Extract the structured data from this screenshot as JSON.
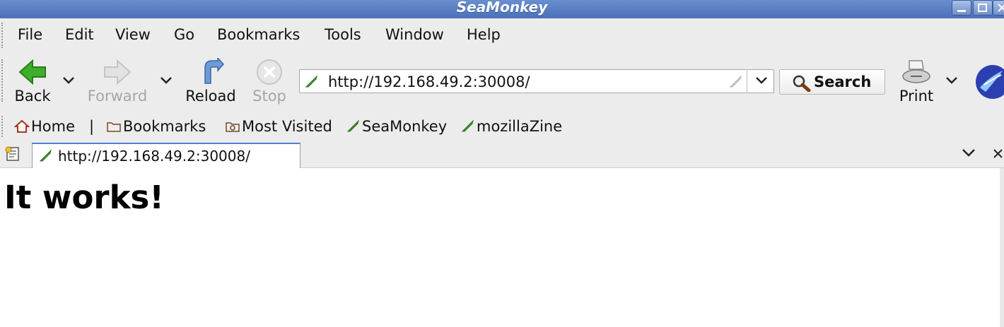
{
  "window": {
    "title": "SeaMonkey"
  },
  "menu": {
    "items": [
      {
        "label": "File"
      },
      {
        "label": "Edit"
      },
      {
        "label": "View"
      },
      {
        "label": "Go"
      },
      {
        "label": "Bookmarks"
      },
      {
        "label": "Tools"
      },
      {
        "label": "Window"
      },
      {
        "label": "Help"
      }
    ]
  },
  "toolbar": {
    "back_label": "Back",
    "forward_label": "Forward",
    "reload_label": "Reload",
    "stop_label": "Stop",
    "search_label": "Search",
    "print_label": "Print",
    "url": "http://192.168.49.2:30008/",
    "icons": {
      "back": "back-arrow-icon",
      "forward": "forward-arrow-icon",
      "reload": "reload-icon",
      "stop": "stop-icon",
      "search": "magnifier-icon",
      "print": "printer-icon",
      "throbber": "seamonkey-logo-icon"
    }
  },
  "bookmarks": {
    "items": [
      {
        "label": "Home",
        "icon": "home-icon"
      },
      {
        "label": "|",
        "icon": ""
      },
      {
        "label": "Bookmarks",
        "icon": "folder-icon"
      },
      {
        "label": "Most Visited",
        "icon": "folder-icon"
      },
      {
        "label": "SeaMonkey",
        "icon": "bookmark-leaf-icon"
      },
      {
        "label": "mozillaZine",
        "icon": "bookmark-leaf-icon"
      }
    ]
  },
  "tabs": {
    "items": [
      {
        "label": "http://192.168.49.2:30008/",
        "active": true
      }
    ]
  },
  "content": {
    "heading": "It works!"
  },
  "colors": {
    "titlebar": "#5a7fc4",
    "chrome": "#ececec",
    "tab_accent": "#4f7ed6",
    "back_icon": "#3fae2a"
  }
}
